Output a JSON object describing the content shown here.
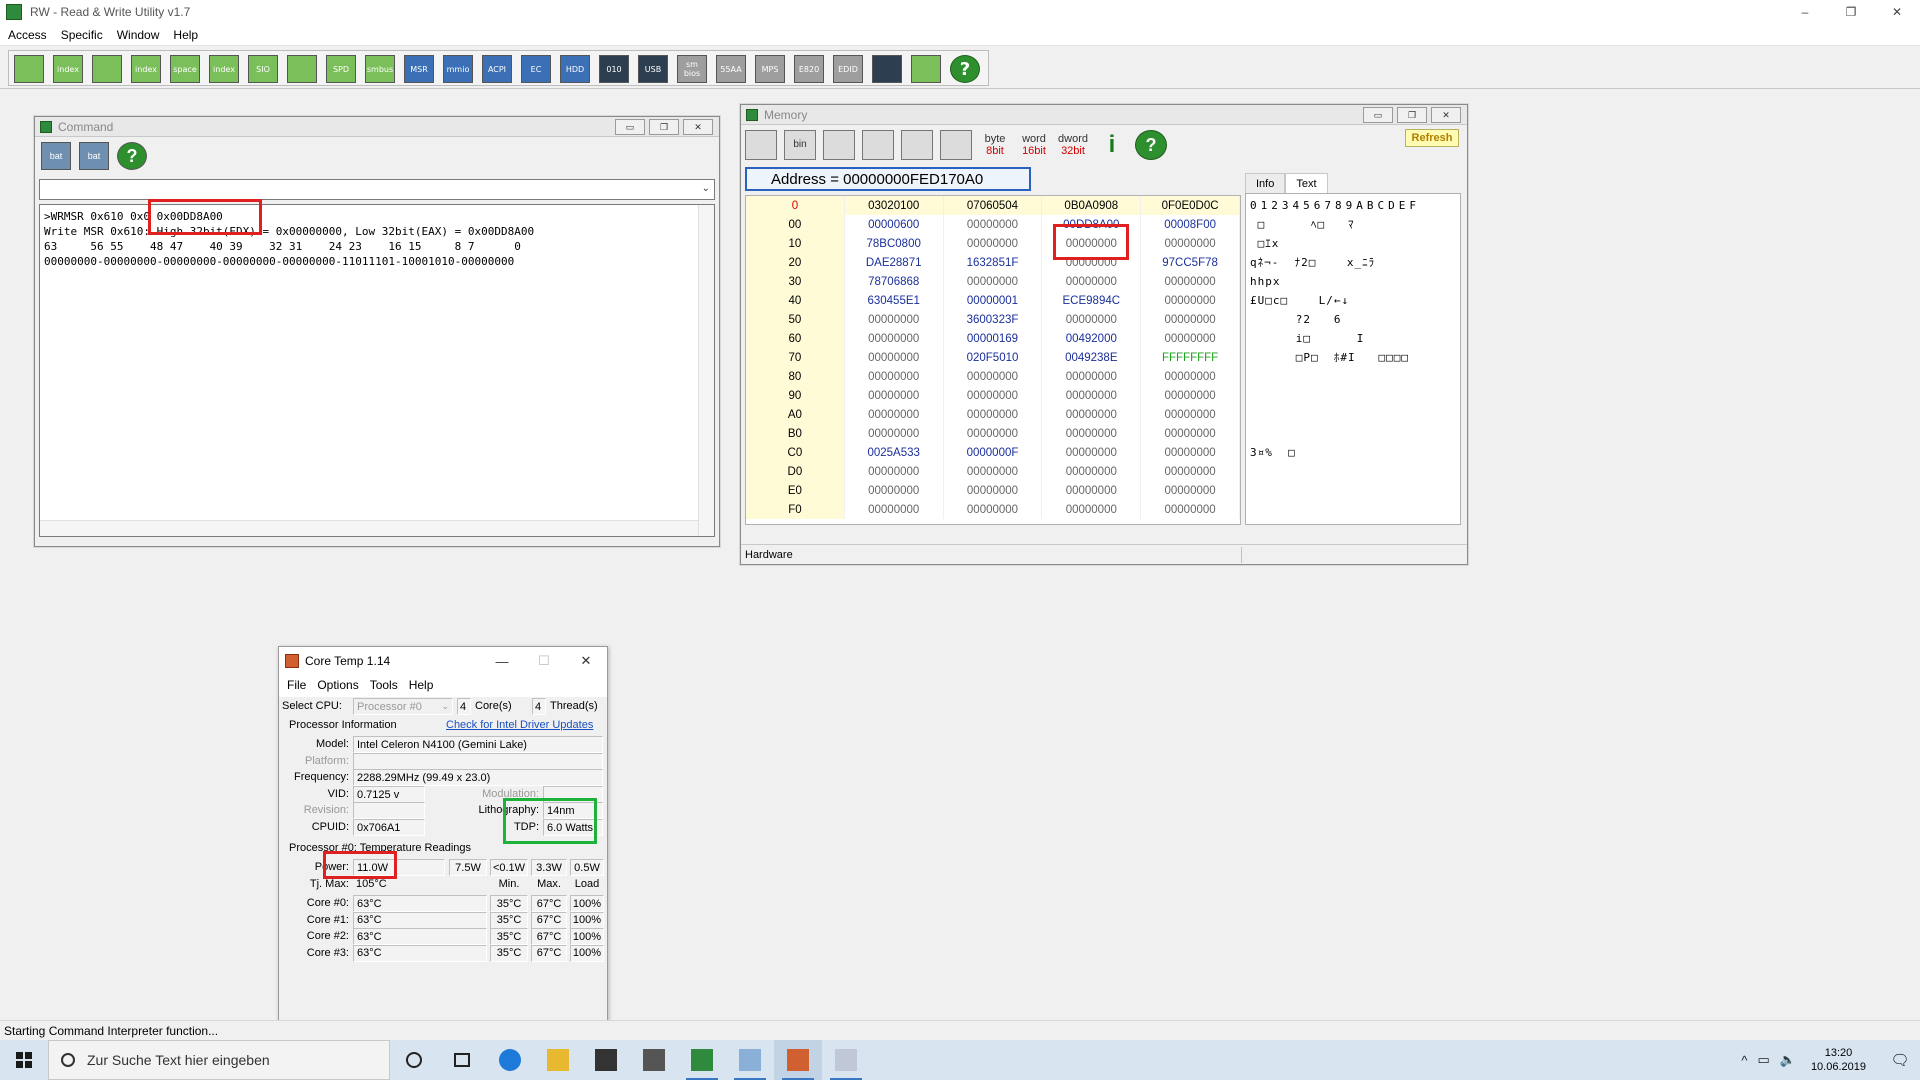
{
  "app": {
    "title": "RW - Read & Write Utility v1.7",
    "controls": [
      "–",
      "❐",
      "✕"
    ],
    "menu": [
      "Access",
      "Specific",
      "Window",
      "Help"
    ],
    "toolbar_icons": [
      {
        "name": "pci-icon",
        "label": ""
      },
      {
        "name": "index-icon",
        "label": "index"
      },
      {
        "name": "memory-icon",
        "label": ""
      },
      {
        "name": "index-memory-icon",
        "label": "index"
      },
      {
        "name": "io-space-icon",
        "label": "space"
      },
      {
        "name": "io-index-icon",
        "label": "index"
      },
      {
        "name": "sio-icon",
        "label": "SIO"
      },
      {
        "name": "oscilloscope-icon",
        "label": ""
      },
      {
        "name": "spd-icon",
        "label": "SPD"
      },
      {
        "name": "smbus-icon",
        "label": "smbus"
      },
      {
        "name": "msr-icon",
        "label": "MSR"
      },
      {
        "name": "mmio-icon",
        "label": "mmio"
      },
      {
        "name": "acpi-icon",
        "label": "ACPI"
      },
      {
        "name": "ec-icon",
        "label": "EC"
      },
      {
        "name": "disk-icon",
        "label": "HDD"
      },
      {
        "name": "binary-icon",
        "label": "010"
      },
      {
        "name": "usb-icon",
        "label": "USB"
      },
      {
        "name": "smbios-icon",
        "label": "sm bios"
      },
      {
        "name": "55aa-icon",
        "label": "55AA"
      },
      {
        "name": "mps-icon",
        "label": "MPS"
      },
      {
        "name": "e820-icon",
        "label": "E820"
      },
      {
        "name": "edid-icon",
        "label": "EDID"
      },
      {
        "name": "monitor-icon",
        "label": ""
      },
      {
        "name": "battery-icon",
        "label": ""
      },
      {
        "name": "help-icon",
        "label": "?"
      }
    ],
    "status": "Starting Command Interpreter function..."
  },
  "command_window": {
    "title": "Command",
    "toolbar": [
      {
        "name": "load-batch-icon",
        "label": "bat"
      },
      {
        "name": "save-batch-icon",
        "label": "bat"
      },
      {
        "name": "help-icon",
        "label": "?"
      }
    ],
    "input_value": "",
    "output_lines": [
      ">WRMSR 0x610 0x0 0x00DD8A00",
      "Write MSR 0x610: High 32bit(EDX) = 0x00000000, Low 32bit(EAX) = 0x00DD8A00",
      "63     56 55    48 47    40 39    32 31    24 23    16 15     8 7      0",
      "00000000-00000000-00000000-00000000-00000000-11011101-10001010-00000000"
    ]
  },
  "memory_window": {
    "title": "Memory",
    "toolbar": [
      {
        "name": "save-icon",
        "label": ""
      },
      {
        "name": "bin-icon",
        "label": "bin"
      },
      {
        "name": "copy-icon",
        "label": ""
      },
      {
        "name": "paste-icon",
        "label": ""
      },
      {
        "name": "find-icon",
        "label": ""
      },
      {
        "name": "edit-icon",
        "label": ""
      }
    ],
    "bit_buttons": [
      {
        "top": "byte",
        "bits": "8bit"
      },
      {
        "top": "word",
        "bits": "16bit"
      },
      {
        "top": "dword",
        "bits": "32bit"
      }
    ],
    "info_label": "i",
    "help_label": "?",
    "refresh_label": "Refresh",
    "address": "Address = 00000000FED170A0",
    "tabs": [
      "Info",
      "Text"
    ],
    "active_tab": "Text",
    "header": [
      "0",
      "03020100",
      "07060504",
      "0B0A0908",
      "0F0E0D0C"
    ],
    "rows": [
      [
        "00",
        "00000600",
        "00000000",
        "00DD8A00",
        "00008F00"
      ],
      [
        "10",
        "78BC0800",
        "00000000",
        "00000000",
        "00000000"
      ],
      [
        "20",
        "DAE28871",
        "1632851F",
        "00000000",
        "97CC5F78"
      ],
      [
        "30",
        "78706868",
        "00000000",
        "00000000",
        "00000000"
      ],
      [
        "40",
        "630455E1",
        "00000001",
        "ECE9894C",
        "00000000"
      ],
      [
        "50",
        "00000000",
        "3600323F",
        "00000000",
        "00000000"
      ],
      [
        "60",
        "00000000",
        "00000169",
        "00492000",
        "00000000"
      ],
      [
        "70",
        "00000000",
        "020F5010",
        "0049238E",
        "FFFFFFFF"
      ],
      [
        "80",
        "00000000",
        "00000000",
        "00000000",
        "00000000"
      ],
      [
        "90",
        "00000000",
        "00000000",
        "00000000",
        "00000000"
      ],
      [
        "A0",
        "00000000",
        "00000000",
        "00000000",
        "00000000"
      ],
      [
        "B0",
        "00000000",
        "00000000",
        "00000000",
        "00000000"
      ],
      [
        "C0",
        "0025A533",
        "0000000F",
        "00000000",
        "00000000"
      ],
      [
        "D0",
        "00000000",
        "00000000",
        "00000000",
        "00000000"
      ],
      [
        "E0",
        "00000000",
        "00000000",
        "00000000",
        "00000000"
      ],
      [
        "F0",
        "00000000",
        "00000000",
        "00000000",
        "00000000"
      ]
    ],
    "text_header": "0123456789ABCDEF",
    "text_lines": [
      " □      ﾍ□   ﾏ",
      " □ｴx",
      "qﾈ¬-  ﾅ2□    x_ﾆﾗ",
      "hhpx",
      "£U□c□    L/←↓",
      "      ?2   6",
      "      i□      I",
      "      □P□  ﾎ#I   □□□□",
      "",
      "",
      "",
      "",
      "3¤%  □",
      "",
      "",
      ""
    ],
    "status": "Hardware"
  },
  "coretemp": {
    "title": "Core Temp 1.14",
    "controls": [
      "—",
      "☐",
      "✕"
    ],
    "menu": [
      "File",
      "Options",
      "Tools",
      "Help"
    ],
    "select_cpu_label": "Select CPU:",
    "select_cpu_value": "Processor #0",
    "cores_count": "4",
    "cores_label": "Core(s)",
    "threads_count": "4",
    "threads_label": "Thread(s)",
    "proc_info_label": "Processor Information",
    "driver_link": "Check for Intel Driver Updates",
    "model_label": "Model:",
    "model_value": "Intel Celeron N4100 (Gemini Lake)",
    "platform_label": "Platform:",
    "platform_value": "",
    "frequency_label": "Frequency:",
    "frequency_value": "2288.29MHz (99.49 x 23.0)",
    "vid_label": "VID:",
    "vid_value": "0.7125 v",
    "modulation_label": "Modulation:",
    "modulation_value": "",
    "revision_label": "Revision:",
    "revision_value": "",
    "lithography_label": "Lithography:",
    "lithography_value": "14nm",
    "cpuid_label": "CPUID:",
    "cpuid_value": "0x706A1",
    "tdp_label": "TDP:",
    "tdp_value": "6.0 Watts",
    "temps_label": "Processor #0: Temperature Readings",
    "power_label": "Power:",
    "power_values": [
      "11.0W",
      "7.5W",
      "<0.1W",
      "3.3W",
      "0.5W"
    ],
    "tjmax_label": "Tj. Max:",
    "tjmax_value": "105°C",
    "col_headers": [
      "Min.",
      "Max.",
      "Load"
    ],
    "cores": [
      {
        "label": "Core #0:",
        "temp": "63°C",
        "min": "35°C",
        "max": "67°C",
        "load": "100%"
      },
      {
        "label": "Core #1:",
        "temp": "63°C",
        "min": "35°C",
        "max": "67°C",
        "load": "100%"
      },
      {
        "label": "Core #2:",
        "temp": "63°C",
        "min": "35°C",
        "max": "67°C",
        "load": "100%"
      },
      {
        "label": "Core #3:",
        "temp": "63°C",
        "min": "35°C",
        "max": "67°C",
        "load": "100%"
      }
    ]
  },
  "taskbar": {
    "search_placeholder": "Zur Suche Text hier eingeben",
    "apps": [
      "cortana",
      "task-view",
      "edge",
      "explorer",
      "store",
      "mail",
      "rw-utility",
      "app-blue",
      "core-temp",
      "app-paint"
    ],
    "tray_symbols": [
      "^",
      "▭",
      "🔈"
    ],
    "time": "13:20",
    "date": "10.06.2019",
    "notification": "🗨"
  },
  "colors": {
    "highlight_red": "#e02020",
    "highlight_green": "#1db33a",
    "memory_nonzero": "#1a2f9a",
    "memory_ff": "#20a020",
    "accent_blue": "#2a60c0"
  }
}
